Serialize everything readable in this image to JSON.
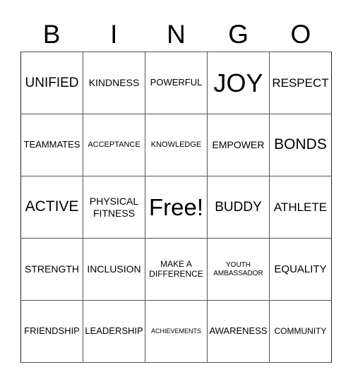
{
  "header": [
    "B",
    "I",
    "N",
    "G",
    "O"
  ],
  "cells": [
    [
      "UNIFIED",
      "KINDNESS",
      "POWERFUL",
      "JOY",
      "RESPECT"
    ],
    [
      "TEAMMATES",
      "ACCEPTANCE",
      "KNOWLEDGE",
      "EMPOWER",
      "BONDS"
    ],
    [
      "ACTIVE",
      "PHYSICAL FITNESS",
      "Free!",
      "BUDDY",
      "ATHLETE"
    ],
    [
      "STRENGTH",
      "INCLUSION",
      "MAKE A DIFFERENCE",
      "YOUTH AMBASSADOR",
      "EQUALITY"
    ],
    [
      "FRIENDSHIP",
      "LEADERSHIP",
      "ACHIEVEMENTS",
      "AWARENESS",
      "COMMUNITY"
    ]
  ]
}
